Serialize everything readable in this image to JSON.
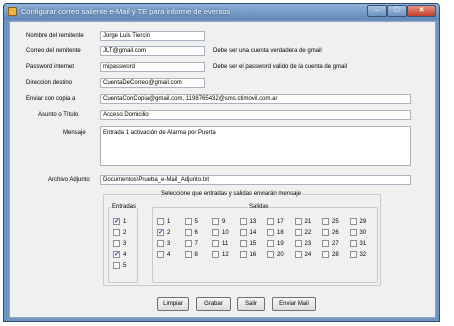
{
  "window": {
    "title": "Configurar correo saliente e-Mail y TE para informe de eventos"
  },
  "form": {
    "remitente": {
      "label": "Nombre del remitente",
      "value": "Jorge Luis Tiercin"
    },
    "correo": {
      "label": "Correo del remitente",
      "value": "JLT@gmail.com",
      "hint": "Debe ser una cuenta verdadera de gmail"
    },
    "password": {
      "label": "Password internet",
      "value": "mipassword",
      "hint": "Debe ser el password valido de la cuenta de gmail"
    },
    "destino": {
      "label": "Direccion destino",
      "value": "CuentaDeCorreo@gmail.com"
    },
    "copia": {
      "label": "Enviar con copia a",
      "value": "CuentaConCopia@gmail.com, 1198765432@sms.ctimovil.com.ar"
    },
    "asunto": {
      "label": "Asunto o Título",
      "value": "Acceso Domicilio"
    },
    "mensaje": {
      "label": "Mensaje",
      "value": "Entrada 1 activación de Alarma por Puerta"
    },
    "adjunto": {
      "label": "Archivo Adjunto",
      "value": "Documentos\\Prueba_e-Mail_Adjunto.txt"
    }
  },
  "selection": {
    "title": "Seleccione que entradas y salidas enviarán mensaje",
    "entradas_label": "Entradas",
    "salidas_label": "Salidas",
    "check_mark": "✓",
    "entradas": [
      {
        "label": "1",
        "checked": true
      },
      {
        "label": "2",
        "checked": false
      },
      {
        "label": "3",
        "checked": false
      },
      {
        "label": "4",
        "checked": true
      },
      {
        "label": "5",
        "checked": false
      }
    ],
    "salidas": [
      {
        "label": "1",
        "checked": false
      },
      {
        "label": "2",
        "checked": true
      },
      {
        "label": "3",
        "checked": false
      },
      {
        "label": "4",
        "checked": false
      },
      {
        "label": "5",
        "checked": false
      },
      {
        "label": "6",
        "checked": false
      },
      {
        "label": "7",
        "checked": false
      },
      {
        "label": "8",
        "checked": false
      },
      {
        "label": "9",
        "checked": false
      },
      {
        "label": "10",
        "checked": false
      },
      {
        "label": "11",
        "checked": false
      },
      {
        "label": "12",
        "checked": false
      },
      {
        "label": "13",
        "checked": false
      },
      {
        "label": "14",
        "checked": false
      },
      {
        "label": "15",
        "checked": false
      },
      {
        "label": "16",
        "checked": false
      },
      {
        "label": "17",
        "checked": false
      },
      {
        "label": "18",
        "checked": false
      },
      {
        "label": "19",
        "checked": false
      },
      {
        "label": "20",
        "checked": false
      },
      {
        "label": "21",
        "checked": false
      },
      {
        "label": "22",
        "checked": false
      },
      {
        "label": "23",
        "checked": false
      },
      {
        "label": "24",
        "checked": false
      },
      {
        "label": "25",
        "checked": false
      },
      {
        "label": "26",
        "checked": false
      },
      {
        "label": "27",
        "checked": false
      },
      {
        "label": "28",
        "checked": false
      },
      {
        "label": "29",
        "checked": false
      },
      {
        "label": "30",
        "checked": false
      },
      {
        "label": "31",
        "checked": false
      },
      {
        "label": "32",
        "checked": false
      }
    ]
  },
  "buttons": {
    "limpiar": "Limpiar",
    "grabar": "Grabar",
    "salir": "Salir",
    "enviar": "Enviar Mail"
  },
  "icons": {
    "app": "envelope-app-icon",
    "minimize": "minimize-icon",
    "maximize": "maximize-icon",
    "close": "close-icon"
  },
  "colors": {
    "titlebar": "#6f95c0",
    "close": "#c0402b",
    "background": "#f0f0f0"
  }
}
